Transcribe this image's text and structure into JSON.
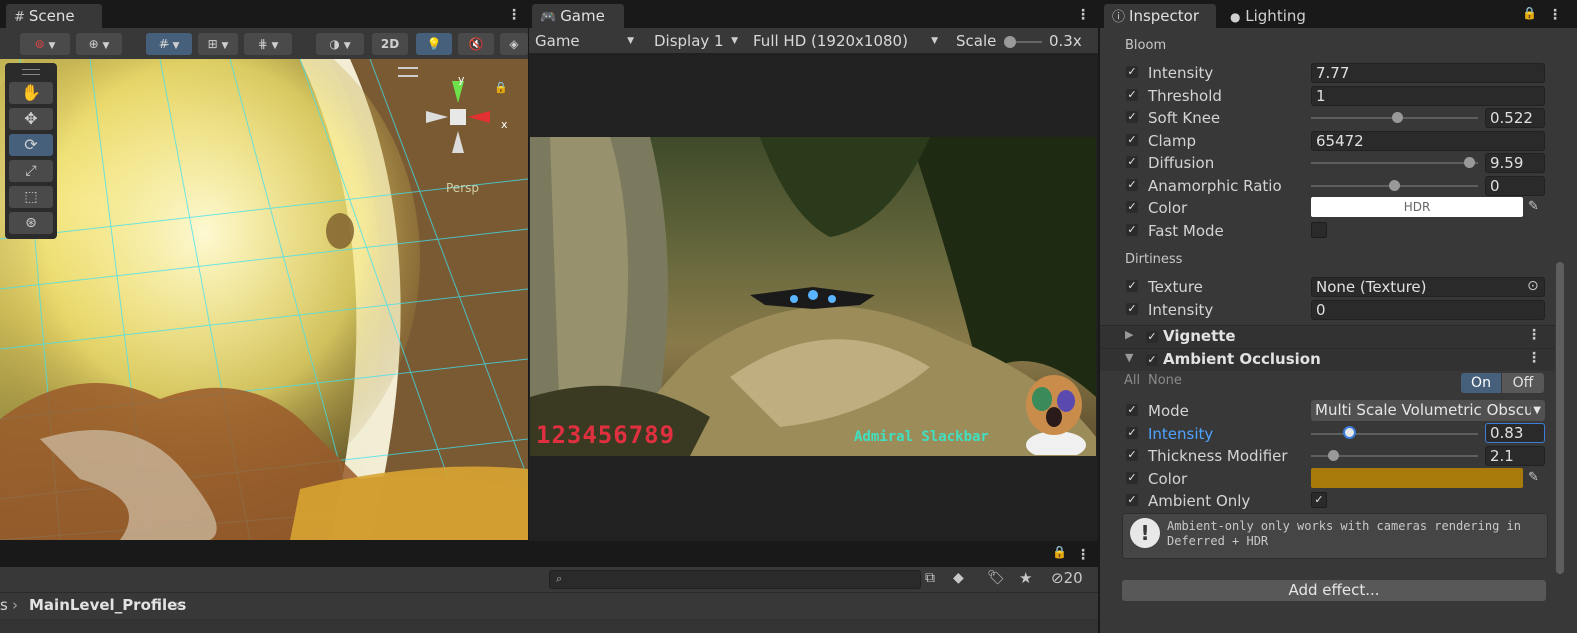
{
  "scene": {
    "tab_label": "Scene",
    "tools": [
      "hand-tool",
      "move-tool",
      "rotate-tool",
      "scale-tool",
      "rect-tool",
      "transform-tool"
    ],
    "gizmo": {
      "y_label": "y",
      "x_label": "x",
      "persp_label": "Persp"
    },
    "toolbar_2d": "2D"
  },
  "game": {
    "tab_label": "Game",
    "mode_select": "Game",
    "display_select": "Display 1",
    "resolution_select": "Full HD (1920x1080)",
    "scale_label": "Scale",
    "scale_value": "0.3x",
    "hud_score": "123456789",
    "hud_name": "Admiral Slackbar"
  },
  "inspector": {
    "tabs": [
      {
        "label": "Inspector",
        "icon": "info-icon"
      },
      {
        "label": "Lighting",
        "icon": "lightbulb-icon"
      }
    ],
    "bloom": {
      "section_label": "Bloom",
      "intensity": {
        "label": "Intensity",
        "value": "7.77"
      },
      "threshold": {
        "label": "Threshold",
        "value": "1"
      },
      "soft_knee": {
        "label": "Soft Knee",
        "value": "0.522",
        "fraction": 0.522
      },
      "clamp": {
        "label": "Clamp",
        "value": "65472"
      },
      "diffusion": {
        "label": "Diffusion",
        "value": "9.59",
        "fraction": 0.95
      },
      "anamorphic": {
        "label": "Anamorphic Ratio",
        "value": "0",
        "fraction": 0.5
      },
      "color": {
        "label": "Color",
        "value": "HDR",
        "swatch": "#ffffff"
      },
      "fast_mode": {
        "label": "Fast Mode"
      }
    },
    "dirtiness": {
      "section_label": "Dirtiness",
      "texture": {
        "label": "Texture",
        "value": "None (Texture)"
      },
      "intensity": {
        "label": "Intensity",
        "value": "0"
      }
    },
    "vignette": {
      "title": "Vignette"
    },
    "ambient_occlusion": {
      "title": "Ambient Occlusion",
      "all_label": "All",
      "none_label": "None",
      "on_label": "On",
      "off_label": "Off",
      "mode": {
        "label": "Mode",
        "value": "Multi Scale Volumetric Obscu"
      },
      "intensity": {
        "label": "Intensity",
        "value": "0.83",
        "fraction": 0.23
      },
      "thickness": {
        "label": "Thickness Modifier",
        "value": "2.1",
        "fraction": 0.14
      },
      "color": {
        "label": "Color",
        "swatch": "#a87a0a"
      },
      "ambient_only": {
        "label": "Ambient Only"
      },
      "info": "Ambient-only only works with cameras rendering in Deferred + HDR"
    },
    "add_effect": "Add effect..."
  },
  "project": {
    "breadcrumb": [
      "s",
      "MainLevel_Profiles"
    ],
    "hidden_count": "20"
  },
  "colors": {
    "accent": "#46607c",
    "highlight_label": "#4ea2ff",
    "panel": "#383838",
    "dark": "#191919"
  }
}
